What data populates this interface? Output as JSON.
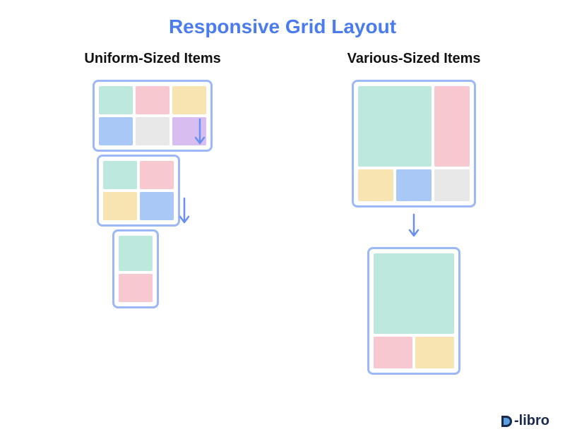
{
  "title": "Responsive Grid Layout",
  "left": {
    "subtitle": "Uniform-Sized Items",
    "frame1_cells": [
      "#bce8de",
      "#f7c8cf",
      "#f8e4b0",
      "#a9c8f5",
      "#e8e8e8",
      "#d7bdf0"
    ],
    "frame2_cells": [
      "#bce8de",
      "#f7c8cf",
      "#f8e4b0",
      "#a9c8f5"
    ],
    "frame3_cells": [
      "#bce8de",
      "#f7c8cf"
    ]
  },
  "right": {
    "subtitle": "Various-Sized Items",
    "frame1": {
      "big": "#bce8de",
      "tall": "#f7c8cf",
      "b1": "#f8e4b0",
      "b2": "#a9c8f5",
      "b3": "#e8e8e8"
    },
    "frame2": {
      "big": "#bce8de",
      "b1": "#f7c8cf",
      "b2": "#f8e4b0"
    }
  },
  "colors": {
    "accent": "#4a7cef",
    "border": "#9db8f7"
  },
  "logo": {
    "text": "-libro",
    "prefix": "D"
  }
}
